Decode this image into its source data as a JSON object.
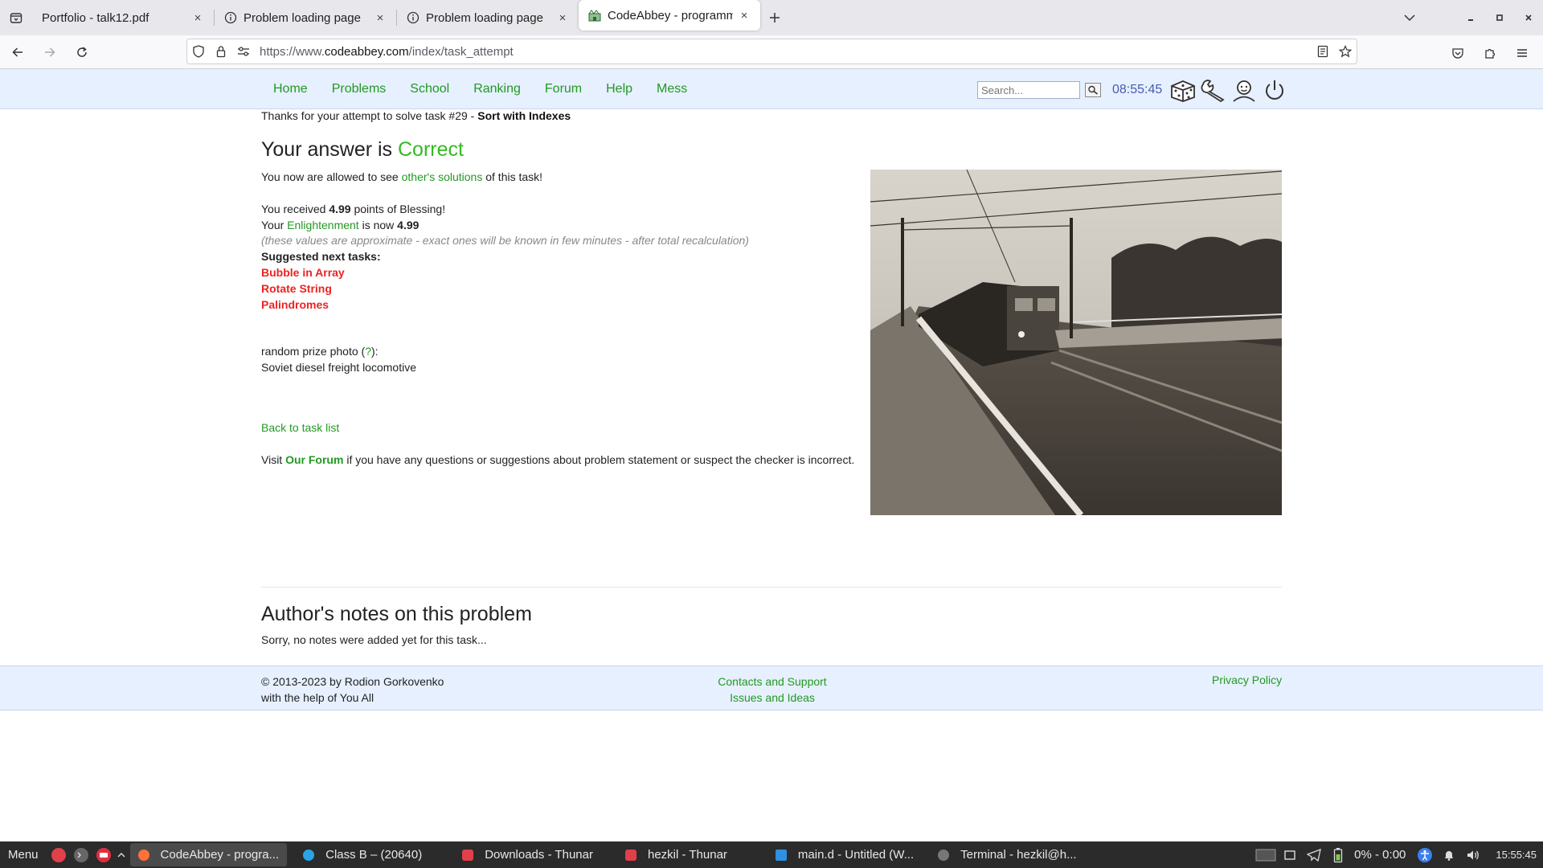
{
  "browser": {
    "tabs": [
      {
        "title": "Portfolio - talk12.pdf",
        "icon": "pdf-icon",
        "active": false
      },
      {
        "title": "Problem loading page",
        "icon": "info-icon",
        "active": false
      },
      {
        "title": "Problem loading page",
        "icon": "info-icon",
        "active": false
      },
      {
        "title": "CodeAbbey - programmin",
        "icon": "codeabbey-favicon",
        "active": true
      }
    ],
    "close_glyph": "×",
    "url_prefix": "https://www.",
    "url_domain": "codeabbey.com",
    "url_path": "/index/task_attempt"
  },
  "site": {
    "nav": [
      "Home",
      "Problems",
      "School",
      "Ranking",
      "Forum",
      "Help",
      "Mess"
    ],
    "search_placeholder": "Search...",
    "clock": "08:55:45",
    "tool_icons": [
      "dice-icon",
      "wrench-icon",
      "user-icon",
      "power-icon"
    ]
  },
  "content": {
    "thanks_text": "Thanks for your attempt to solve task #29 - ",
    "task_name": "Sort with Indexes",
    "answer_prefix": "Your answer is ",
    "answer_status": "Correct",
    "allowed_pre": "You now are allowed to see ",
    "allowed_link": "other's solutions",
    "allowed_post": " of this task!",
    "received_pre": "You received ",
    "received_points": "4.99",
    "received_post": " points of Blessing!",
    "enl_pre": "Your ",
    "enl_link": "Enlightenment",
    "enl_mid": " is now ",
    "enl_value": "4.99",
    "approx_note": "(these values are approximate - exact ones will be known in few minutes - after total recalculation)",
    "suggested_heading": "Suggested next tasks:",
    "suggested": [
      "Bubble in Array",
      "Rotate String",
      "Palindromes"
    ],
    "prize_pre": "random prize photo (",
    "prize_link": "?",
    "prize_post": "):",
    "prize_caption": "Soviet diesel freight locomotive",
    "back_link": "Back to task list",
    "visit_pre": "Visit ",
    "visit_link": "Our Forum",
    "visit_post": " if you have any questions or suggestions about problem statement or suspect the checker is incorrect.",
    "notes_heading": "Author's notes on this problem",
    "notes_text": "Sorry, no notes were added yet for this task..."
  },
  "footer": {
    "copyright": "© 2013-2023 by Rodion Gorkovenko",
    "help": "with the help of You All",
    "contacts": "Contacts and Support",
    "issues": "Issues and Ideas",
    "privacy": "Privacy Policy"
  },
  "taskbar": {
    "menu": "Menu",
    "tasks": [
      {
        "label": "CodeAbbey - progra...",
        "color": "#ff7139",
        "active": true
      },
      {
        "label": "Class B – (20640)",
        "color": "#2aa4e8",
        "active": false
      },
      {
        "label": "Downloads - Thunar",
        "color": "#e0404a",
        "active": false
      },
      {
        "label": "hezkil - Thunar",
        "color": "#e0404a",
        "active": false
      },
      {
        "label": "main.d - Untitled (W...",
        "color": "#2f8fe0",
        "active": false
      },
      {
        "label": "Terminal - hezkil@h...",
        "color": "#777777",
        "active": false
      }
    ],
    "battery": "0% - 0:00",
    "time": "15:55:45"
  },
  "colors": {
    "link": "#229922",
    "correct": "#33bb22",
    "suggest": "#ee2222",
    "header_bg": "#e6f0ff"
  }
}
